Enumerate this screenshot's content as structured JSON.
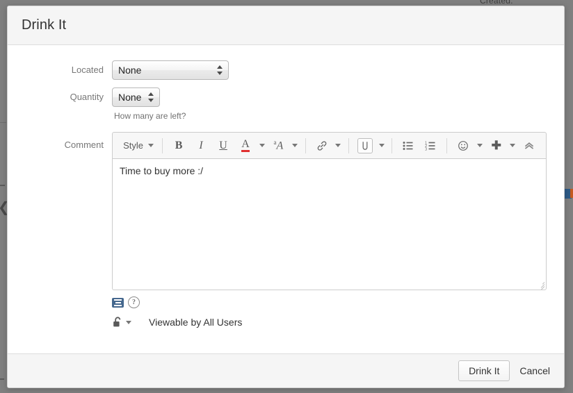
{
  "background": {
    "top_fragment_text": "Created:",
    "left_nav_icon": "chevron-left-icon",
    "right_fragment_text": ""
  },
  "dialog": {
    "title": "Drink It",
    "fields": {
      "located": {
        "label": "Located",
        "value": "None",
        "options": [
          "None"
        ]
      },
      "quantity": {
        "label": "Quantity",
        "value": "None",
        "hint": "How many are left?",
        "options": [
          "None"
        ]
      },
      "comment": {
        "label": "Comment",
        "value": "Time to buy more :/",
        "placeholder": ""
      }
    },
    "editor_toolbar": {
      "style_label": "Style",
      "bold_label": "B",
      "italic_label": "I",
      "underline_label": "U",
      "font_color_label": "A",
      "font_color_swatch": "#e03030",
      "text_effects_label": "A",
      "text_effects_superscript": "a",
      "link_icon": "link-icon",
      "attach_icon": "paperclip-icon",
      "bullet_list_icon": "bullet-list-icon",
      "numbered_list_icon": "numbered-list-icon",
      "emoji_icon": "smiley-icon",
      "insert_icon": "plus-icon",
      "collapse_icon": "double-chevron-up-icon"
    },
    "below_editor": {
      "markup_icon": "markup-source-icon",
      "help_icon": "help-question-icon",
      "help_glyph": "?",
      "lock_icon": "unlock-icon",
      "visibility_label": "Viewable by All Users"
    },
    "footer": {
      "primary_label": "Drink It",
      "secondary_label": "Cancel"
    }
  },
  "colors": {
    "overlay": "#808080",
    "dialog_bg": "#ffffff",
    "header_bg": "#f5f5f5",
    "footer_bg": "#f5f5f5",
    "label_text": "#777777",
    "accent_blue": "#45688e",
    "color_swatch_red": "#e03030"
  }
}
